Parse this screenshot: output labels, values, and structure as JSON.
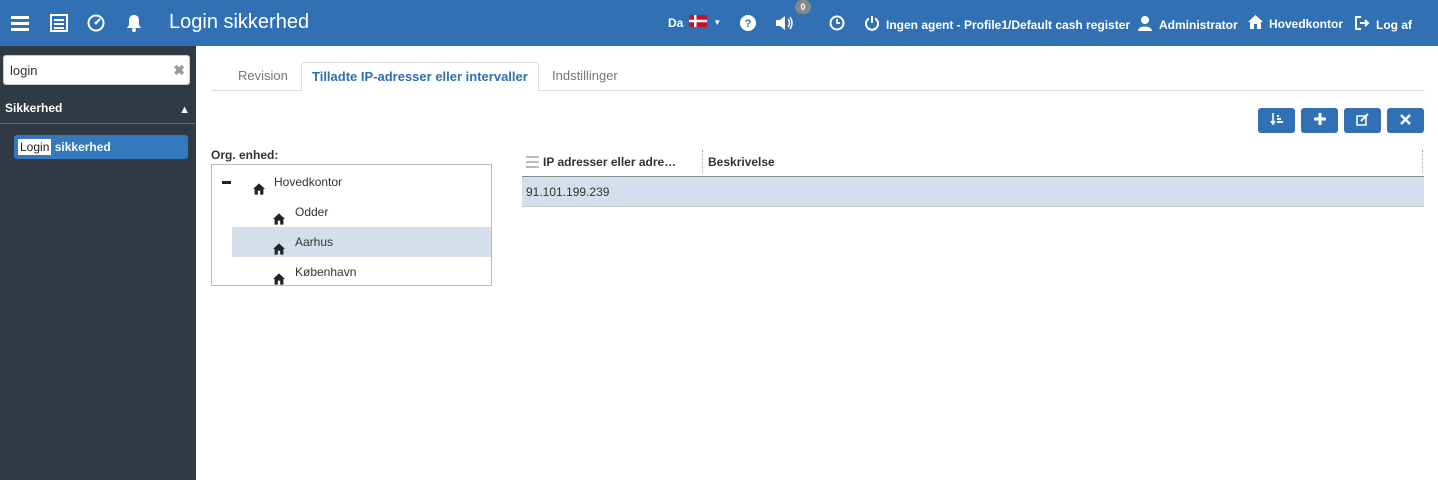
{
  "topbar": {
    "title": "Login sikkerhed",
    "language": "Da",
    "notifications_count": "0",
    "agent": "Ingen agent - Profile1/Default cash register",
    "user": "Administrator",
    "location": "Hovedkontor",
    "logout": "Log af",
    "colors": {
      "bar": "#3070b3",
      "flag_red": "#c8102e"
    }
  },
  "sidebar": {
    "search": {
      "value": "login",
      "placeholder": ""
    },
    "section": "Sikkerhed",
    "item": {
      "highlight": "Login",
      "rest": " sikkerhed"
    }
  },
  "tabs": [
    {
      "label": "Revision"
    },
    {
      "label": "Tilladte IP-adresser eller intervaller"
    },
    {
      "label": "Indstillinger"
    }
  ],
  "toolbar": {
    "icons": [
      "sort-icon",
      "plus-icon",
      "edit-icon",
      "close-icon"
    ]
  },
  "org": {
    "label": "Org. enhed:",
    "nodes": [
      {
        "label": "Hovedkontor"
      },
      {
        "label": "Odder"
      },
      {
        "label": "Aarhus"
      },
      {
        "label": "København"
      }
    ]
  },
  "grid": {
    "columns": [
      "IP adresser eller adre…",
      "Beskrivelse"
    ],
    "rows": [
      {
        "ip": "91.101.199.239",
        "description": ""
      }
    ]
  }
}
